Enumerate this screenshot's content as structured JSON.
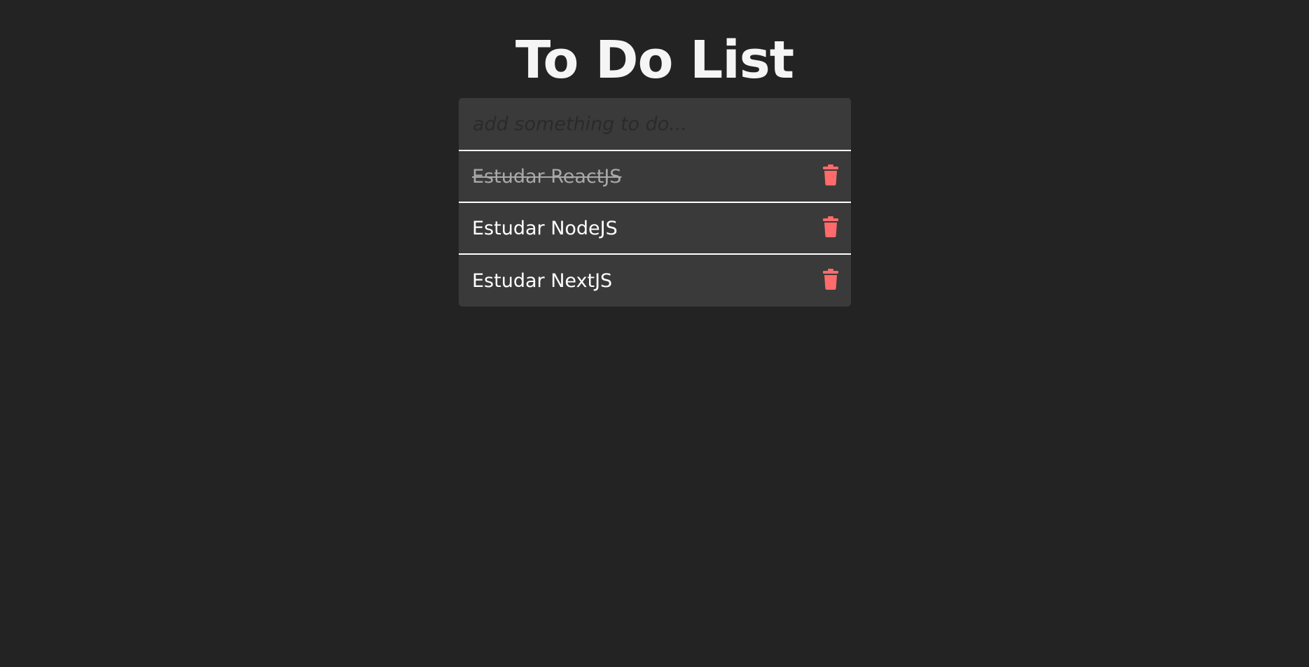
{
  "page": {
    "title": "To Do List"
  },
  "input": {
    "placeholder": "add something to do...",
    "value": ""
  },
  "todos": [
    {
      "text": "Estudar ReactJS",
      "done": true
    },
    {
      "text": "Estudar NodeJS",
      "done": false
    },
    {
      "text": "Estudar NextJS",
      "done": false
    }
  ],
  "icons": {
    "delete": "trash-icon"
  },
  "colors": {
    "background": "#232323",
    "card": "#3a3a3a",
    "divider": "#ffffff",
    "title": "#f5f5f5",
    "text": "#ffffff",
    "done_text": "#a9a9a9",
    "delete_icon": "#ff6b6b"
  }
}
